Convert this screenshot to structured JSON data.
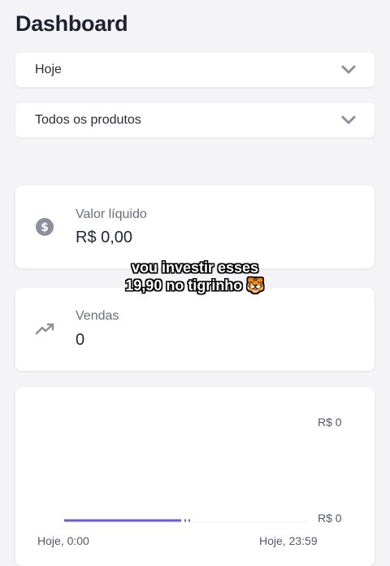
{
  "header": {
    "title": "Dashboard"
  },
  "filters": {
    "period": {
      "value": "Hoje",
      "icon": "chevron-down-icon"
    },
    "product": {
      "value": "Todos os produtos",
      "icon": "chevron-down-icon"
    }
  },
  "cards": {
    "net_value": {
      "label": "Valor líquido",
      "value": "R$ 0,00",
      "icon": "dollar-coin-icon"
    },
    "sales": {
      "label": "Vendas",
      "value": "0",
      "icon": "trending-up-icon"
    }
  },
  "overlay": {
    "line1": "vou investir esses",
    "line2": "19,90 no tigrinho 🐯"
  },
  "chart": {
    "y_top_label": "R$ 0",
    "y_bottom_label": "R$ 0",
    "x_start_label": "Hoje, 0:00",
    "x_end_label": "Hoje, 23:59",
    "line_color": "#6a5bd6"
  },
  "chart_data": {
    "type": "line",
    "x": [
      "Hoje, 0:00",
      "Hoje, 23:59"
    ],
    "series": [
      {
        "values": [
          0,
          0
        ]
      }
    ],
    "ytick_labels": [
      "R$ 0",
      "R$ 0"
    ],
    "xtick_labels": [
      "Hoje, 0:00",
      "Hoje, 23:59"
    ]
  },
  "colors": {
    "background": "#f4f4f6",
    "icon_gray": "#8d8f9c",
    "accent": "#6a5bd6"
  }
}
